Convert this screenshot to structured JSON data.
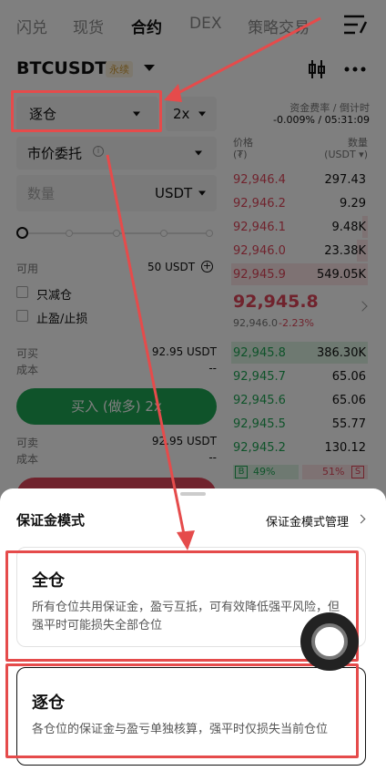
{
  "nav": {
    "tabs": [
      "闪兑",
      "现货",
      "合约",
      "DEX",
      "策略交易"
    ],
    "active_tab": "合约"
  },
  "header": {
    "pair": "BTCUSDT",
    "badge": "永续"
  },
  "order_form": {
    "margin_mode": "逐仓",
    "leverage": "2x",
    "order_type": "市价委托",
    "amount_placeholder": "数量",
    "amount_unit": "USDT",
    "available_label": "可用",
    "available_value": "50 USDT",
    "reduce_only": "只减仓",
    "tp_sl": "止盈/止损",
    "buy_max_label": "可买",
    "buy_max_value": "92.95 USDT",
    "buy_cost_label": "成本",
    "buy_cost_value": "--",
    "buy_button": "买入 (做多) 2x",
    "sell_max_label": "可卖",
    "sell_max_value": "92.95 USDT",
    "sell_cost_label": "成本",
    "sell_cost_value": "--"
  },
  "funding": {
    "label": "资金费率 / 倒计时",
    "value": "-0.009% / 05:31:09"
  },
  "orderbook": {
    "price_header": "价格",
    "price_unit": "(₮)",
    "qty_header": "数量",
    "qty_unit": "(USDT ▾)",
    "asks": [
      {
        "price": "92,946.4",
        "qty": "297.43"
      },
      {
        "price": "92,946.2",
        "qty": "9.29"
      },
      {
        "price": "92,946.1",
        "qty": "9.48K"
      },
      {
        "price": "92,946.0",
        "qty": "23.38K"
      },
      {
        "price": "92,945.9",
        "qty": "549.05K"
      }
    ],
    "last_price": "92,945.8",
    "mark_price": "92,946.0",
    "change": "-2.23%",
    "bids": [
      {
        "price": "92,945.8",
        "qty": "386.30K"
      },
      {
        "price": "92,945.7",
        "qty": "65.06"
      },
      {
        "price": "92,945.6",
        "qty": "65.06"
      },
      {
        "price": "92,945.5",
        "qty": "55.77"
      },
      {
        "price": "92,945.2",
        "qty": "130.12"
      }
    ],
    "buy_ratio_label": "B",
    "buy_ratio": "49%",
    "sell_ratio": "51%",
    "sell_ratio_label": "S"
  },
  "sheet": {
    "title": "保证金模式",
    "manage_link": "保证金模式管理",
    "cross_title": "全仓",
    "cross_desc": "所有仓位共用保证金，盈亏互抵，可有效降低强平风险，但强平时可能损失全部仓位",
    "isolated_title": "逐仓",
    "isolated_desc": "各仓位的保证金与盈亏单独核算，强平时仅损失当前仓位"
  },
  "colors": {
    "ask_red": "#e0475b",
    "bid_green": "#1fa655",
    "annotation_red": "#e54b4b"
  }
}
